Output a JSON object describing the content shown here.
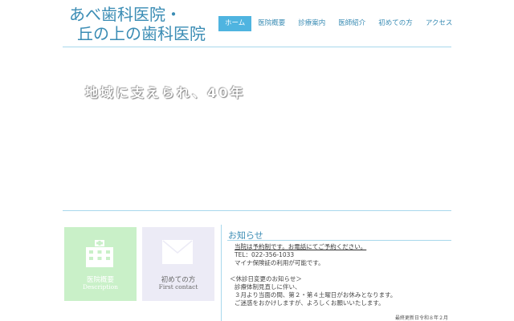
{
  "site": {
    "title_line1": "あべ歯科医院・",
    "title_line2": "丘の上の歯科医院"
  },
  "nav": {
    "items": [
      {
        "label": "ホーム",
        "active": true
      },
      {
        "label": "医院概要"
      },
      {
        "label": "診療案内"
      },
      {
        "label": "医師紹介"
      },
      {
        "label": "初めての方"
      },
      {
        "label": "アクセス"
      }
    ]
  },
  "hero": {
    "tagline": "地域に支えられ、40年"
  },
  "tiles": {
    "clinic": {
      "label": "医院概要",
      "sub": "Description"
    },
    "first": {
      "label": "初めての方",
      "sub": "First contact"
    }
  },
  "news": {
    "heading": "お知らせ",
    "lines": [
      "当院は予約制です。お電話にてご予約ください。",
      "TEL：022-356-1033",
      "マイナ保険証の利用が可能です。",
      "",
      "＜休診日変更のお知らせ＞",
      "診療体制見直しに伴い、",
      "３月より当面の間、第２・第４土曜日がお休みとなります。",
      "ご迷惑をおかけしますが、よろしくお願いいたします。"
    ],
    "updated": "最終更新日令和８年２月"
  },
  "colors": {
    "accent": "#3a8cb4",
    "nav_active": "#4fb4e0",
    "tile1": "#c9f0c8",
    "tile2": "#ecebf6"
  }
}
